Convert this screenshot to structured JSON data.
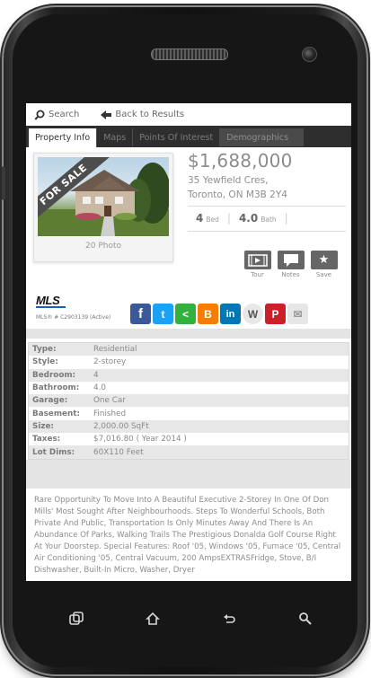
{
  "topbar": {
    "search_label": "Search",
    "back_label": "Back to Results"
  },
  "tabs": [
    {
      "label": "Property Info",
      "active": true
    },
    {
      "label": "Maps",
      "active": false
    },
    {
      "label": "Points Of Interest",
      "active": false
    },
    {
      "label": "Demographics",
      "active": false
    }
  ],
  "listing": {
    "badge": "FOR SALE",
    "photo_count": "20 Photo",
    "price": "$1,688,000",
    "address_line1": "35 Yewfield Cres,",
    "address_line2": "Toronto, ON M3B 2Y4",
    "beds_value": "4",
    "beds_unit": "Bed",
    "baths_value": "4.0",
    "baths_unit": "Bath"
  },
  "actions": [
    {
      "label": "Tour",
      "icon": "video-icon"
    },
    {
      "label": "Notes",
      "icon": "notes-icon"
    },
    {
      "label": "Save",
      "icon": "star-icon"
    }
  ],
  "mls": {
    "logo": "MLS",
    "number": "MLS® # C2903139 (Active)"
  },
  "share_icons": [
    {
      "icon": "facebook-icon",
      "glyph": "f",
      "color": "#3b5998"
    },
    {
      "icon": "twitter-icon",
      "glyph": "t",
      "color": "#1da1f2"
    },
    {
      "icon": "share-icon",
      "glyph": "<",
      "color": "#33b13f"
    },
    {
      "icon": "blogger-icon",
      "glyph": "B",
      "color": "#f57d00"
    },
    {
      "icon": "linkedin-icon",
      "glyph": "in",
      "color": "#0077b5"
    },
    {
      "icon": "wordpress-icon",
      "glyph": "W",
      "color": "#e8e8e8"
    },
    {
      "icon": "pinterest-icon",
      "glyph": "P",
      "color": "#cb2027"
    },
    {
      "icon": "email-icon",
      "glyph": "✉",
      "color": "#e6e6e6"
    }
  ],
  "details": [
    {
      "label": "Type:",
      "value": "Residential"
    },
    {
      "label": "Style:",
      "value": "2-storey"
    },
    {
      "label": "Bedroom:",
      "value": "4"
    },
    {
      "label": "Bathroom:",
      "value": "4.0"
    },
    {
      "label": "Garage:",
      "value": "One Car"
    },
    {
      "label": "Basement:",
      "value": "Finished"
    },
    {
      "label": "Size:",
      "value": "2,000.00 SqFt"
    },
    {
      "label": "Taxes:",
      "value": "$7,016.80 ( Year 2014 )"
    },
    {
      "label": "Lot Dims:",
      "value": "60X110 Feet"
    }
  ],
  "description": "Rare Opportunity To Move Into A Beautiful Executive 2-Storey In One Of Don Mills' Most Sought After Neighbourhoods. Steps To Wonderful Schools, Both Private And Public, Transportation Is Only Minutes Away And There Is An Abundance Of Parks, Walking Trails The Prestigious Donalda Golf Course Right At Your Doorstep. Special Features: Roof '05, Windows '05, Furnace '05, Central Air Conditioning '05, Central Vacuum, 200 AmpsEXTRASFridge, Stove, B/I Dishwasher, Built-In Micro, Washer, Dryer",
  "nav_icons": [
    "recent-apps-icon",
    "home-icon",
    "back-icon",
    "search-icon"
  ]
}
